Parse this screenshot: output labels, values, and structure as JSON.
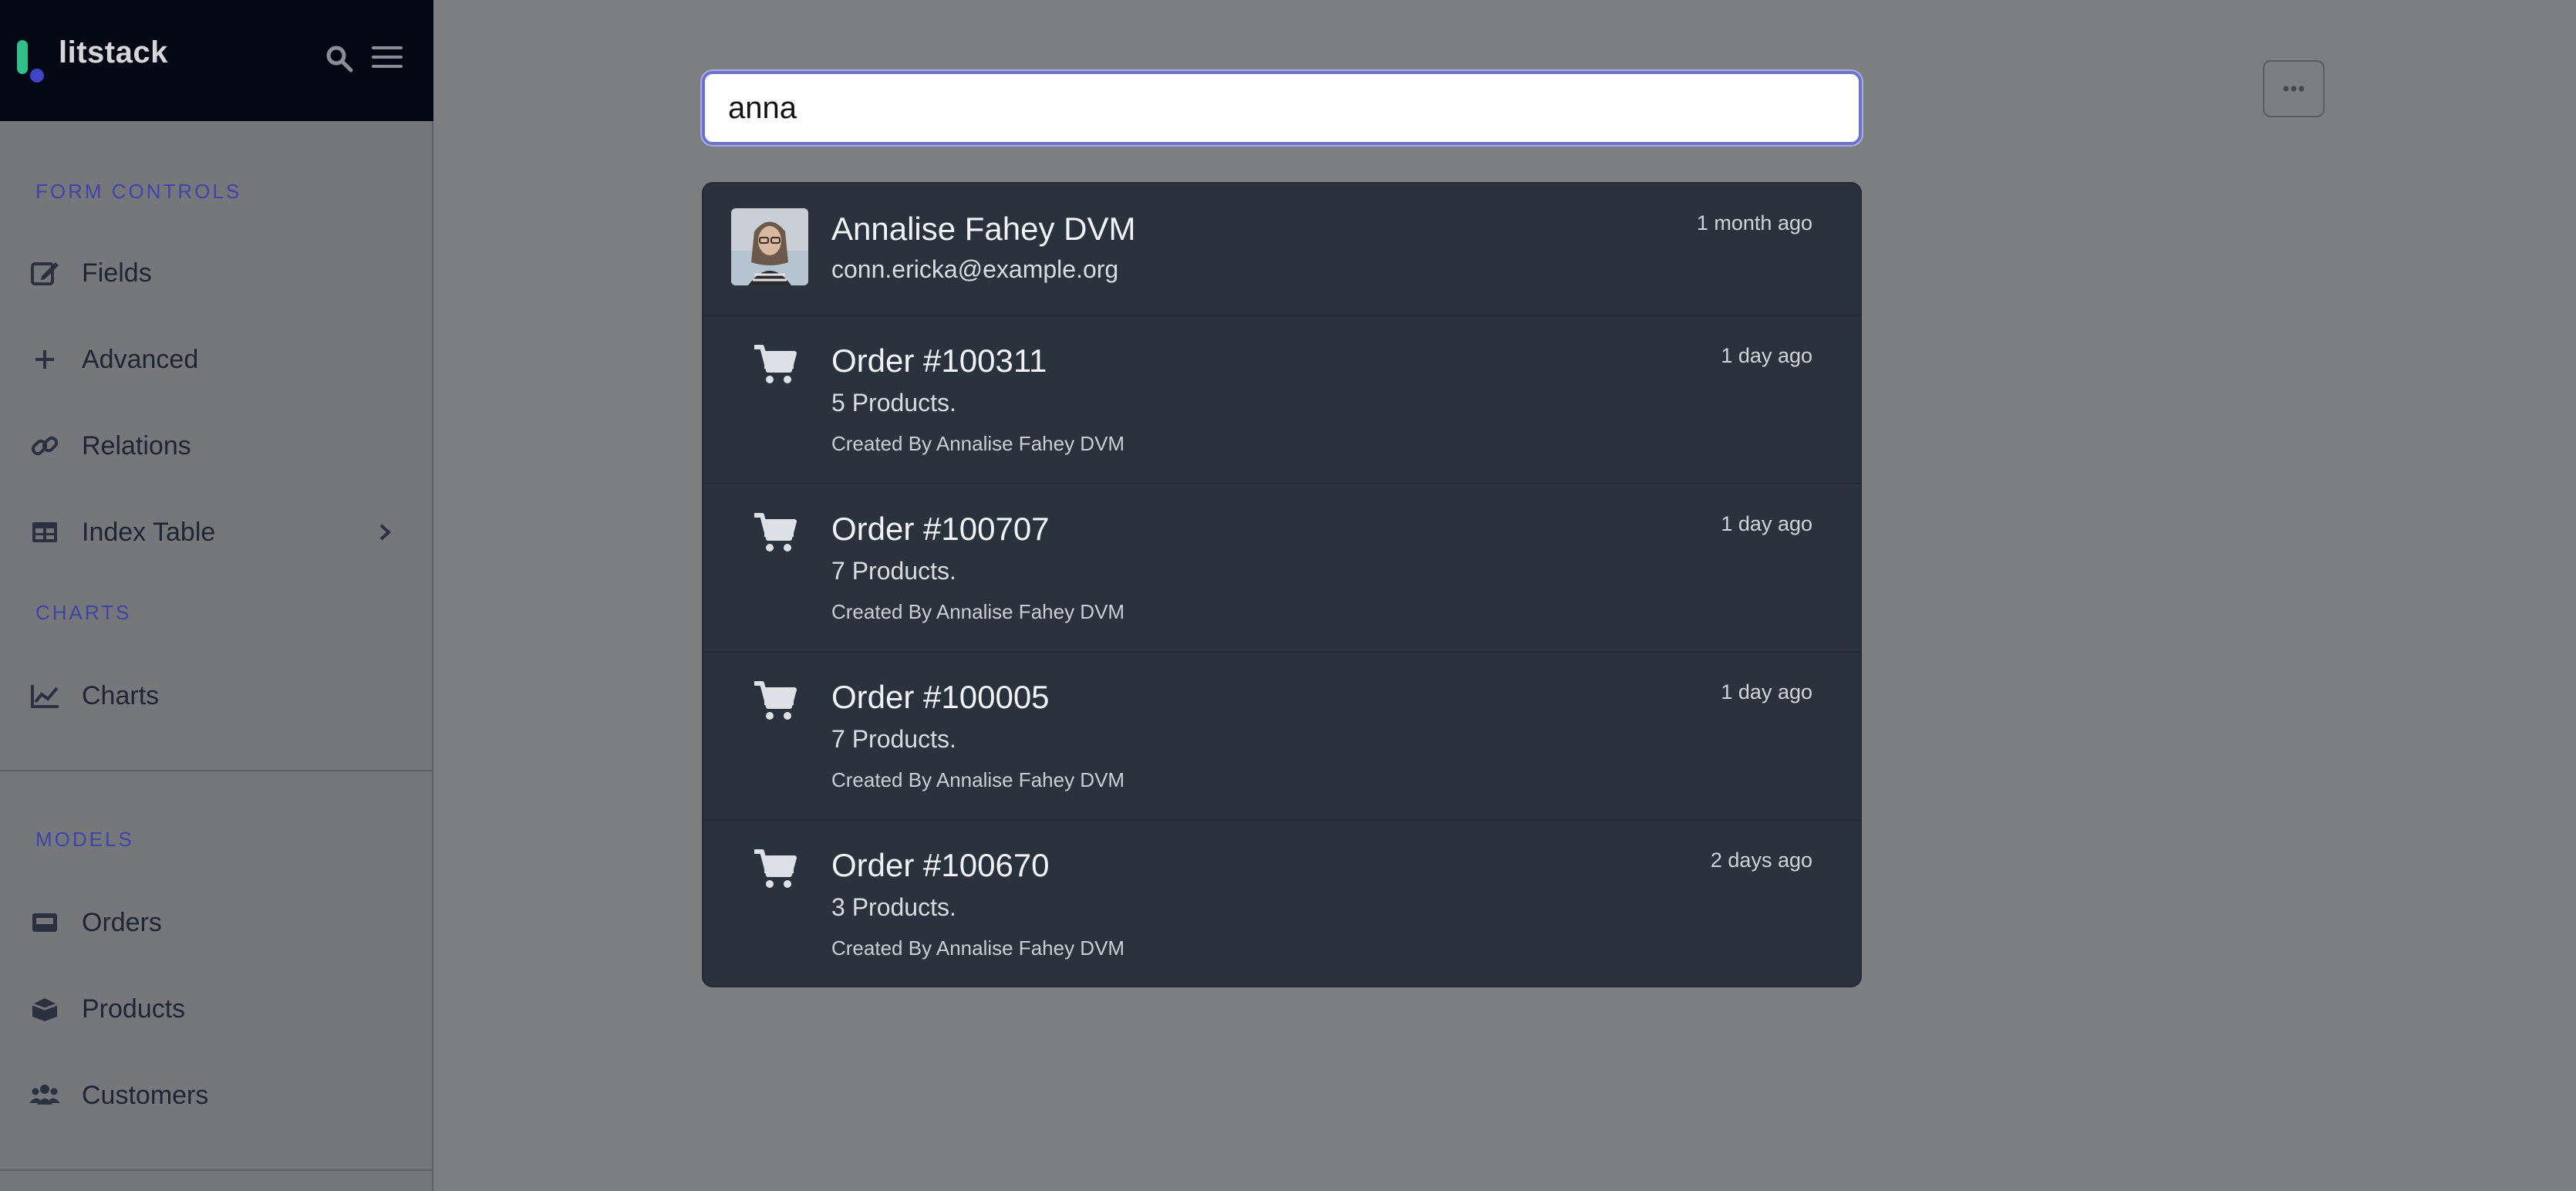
{
  "app": {
    "brand": "litstack"
  },
  "sidebar": {
    "sections": [
      {
        "label": "FORM CONTROLS"
      },
      {
        "label": "CHARTS"
      },
      {
        "label": "MODELS"
      }
    ],
    "items": [
      {
        "label": "Fields",
        "icon": "edit-icon"
      },
      {
        "label": "Advanced",
        "icon": "plus-icon"
      },
      {
        "label": "Relations",
        "icon": "link-icon"
      },
      {
        "label": "Index Table",
        "icon": "table-icon"
      },
      {
        "label": "Charts",
        "icon": "line-chart-icon"
      },
      {
        "label": "Orders",
        "icon": "orders-icon"
      },
      {
        "label": "Products",
        "icon": "box-icon"
      },
      {
        "label": "Customers",
        "icon": "users-icon"
      }
    ]
  },
  "search": {
    "value": "anna"
  },
  "results": [
    {
      "type": "customer",
      "title": "Annalise Fahey DVM",
      "subtitle": "conn.ericka@example.org",
      "time": "1 month ago"
    },
    {
      "type": "order",
      "title": "Order #100311",
      "subtitle": "5 Products.",
      "meta": "Created By Annalise Fahey DVM",
      "time": "1 day ago"
    },
    {
      "type": "order",
      "title": "Order #100707",
      "subtitle": "7 Products.",
      "meta": "Created By Annalise Fahey DVM",
      "time": "1 day ago"
    },
    {
      "type": "order",
      "title": "Order #100005",
      "subtitle": "7 Products.",
      "meta": "Created By Annalise Fahey DVM",
      "time": "1 day ago"
    },
    {
      "type": "order",
      "title": "Order #100670",
      "subtitle": "3 Products.",
      "meta": "Created By Annalise Fahey DVM",
      "time": "2 days ago"
    }
  ],
  "colors": {
    "accent": "#3f45a6",
    "sidebar_dark": "#030914",
    "results_bg": "#2a323d"
  }
}
